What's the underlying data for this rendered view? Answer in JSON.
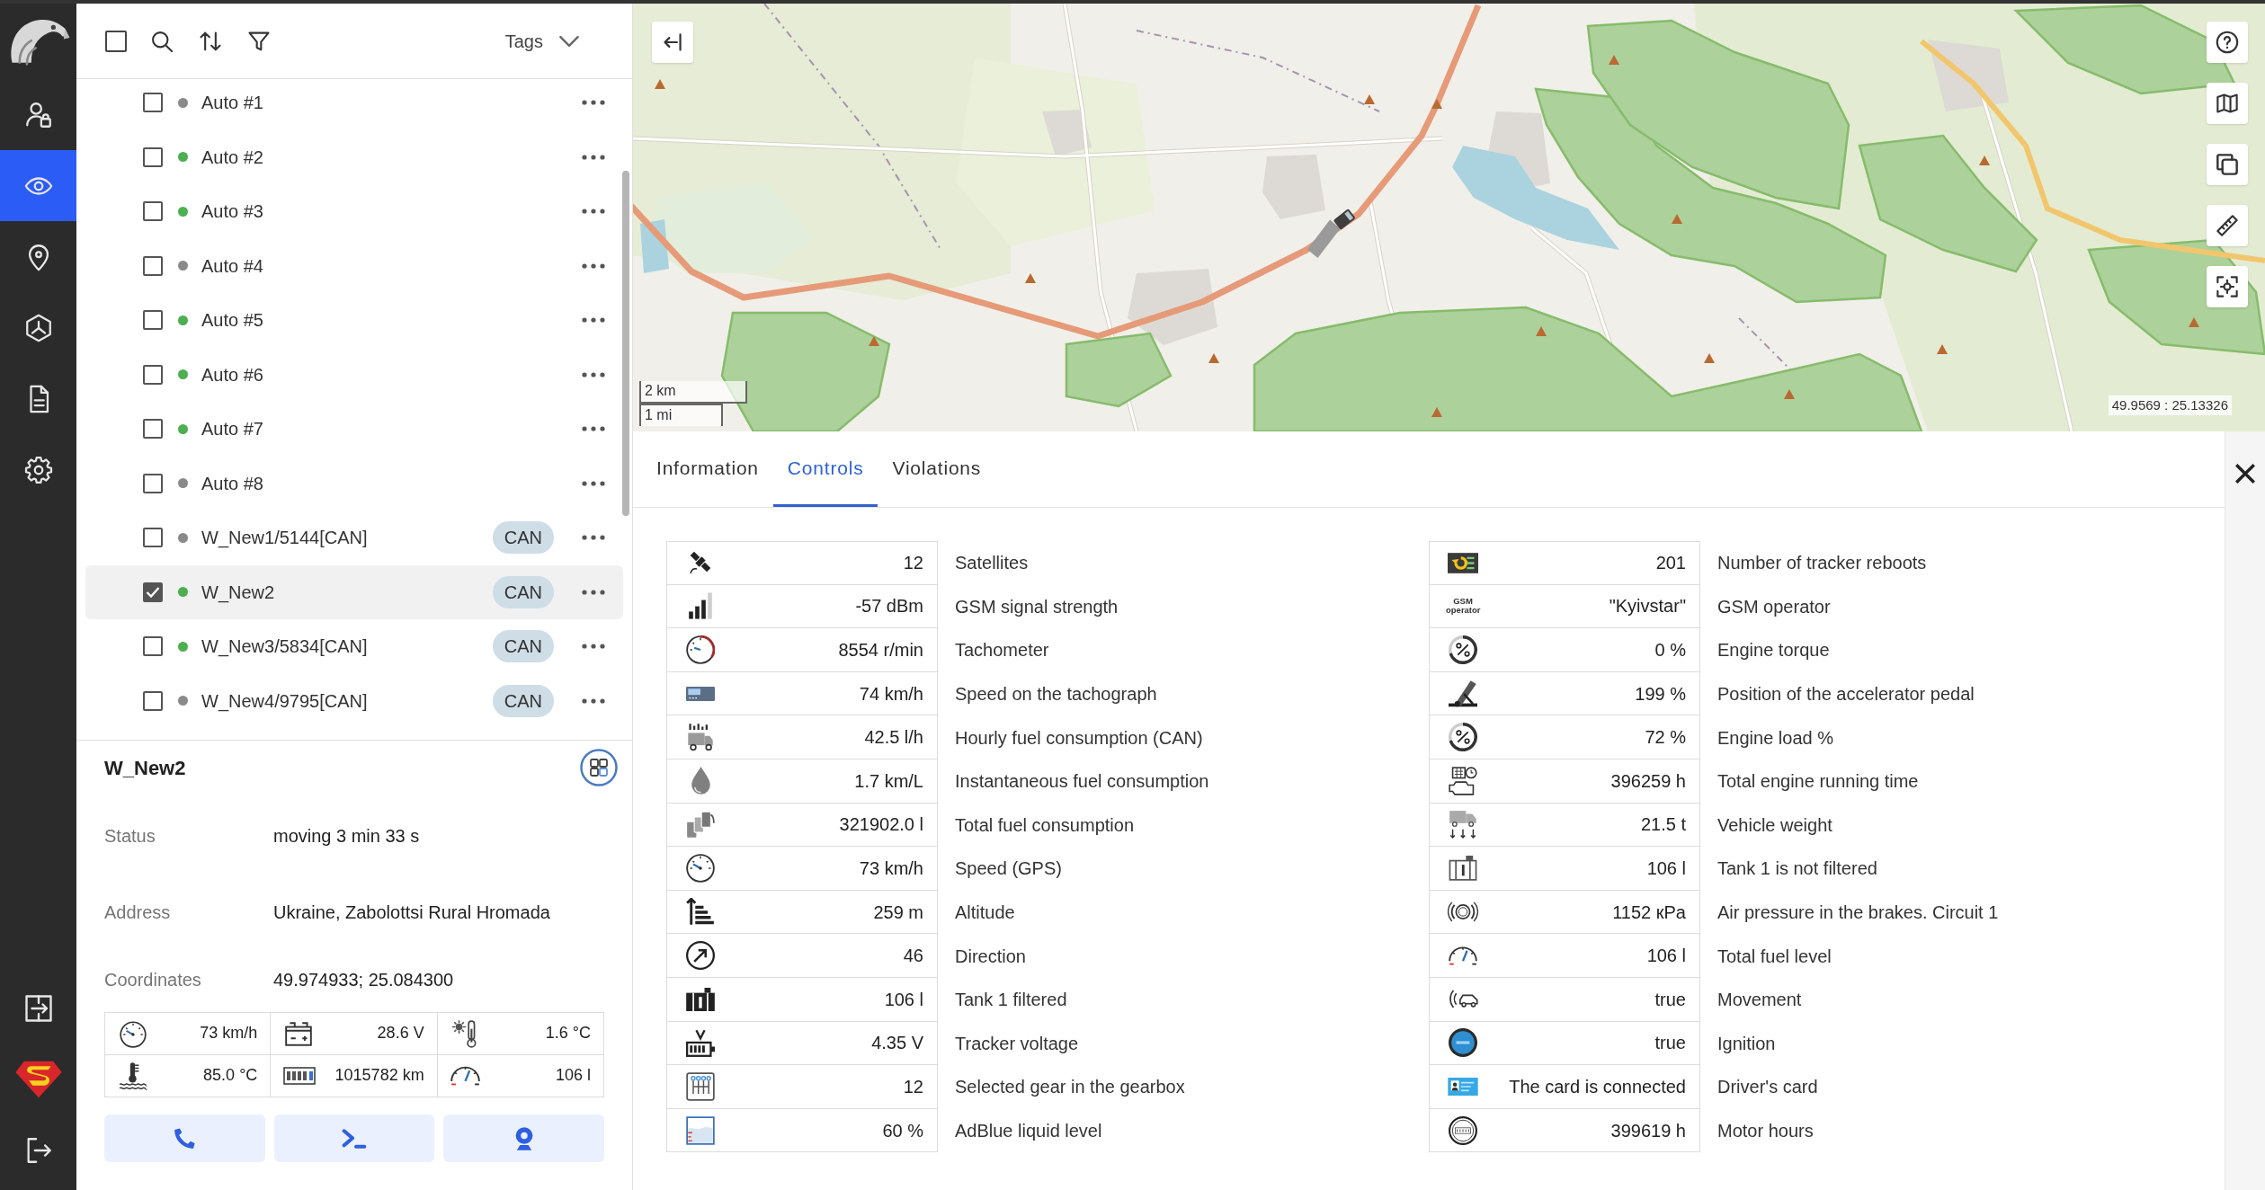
{
  "nav": {
    "items": [
      {
        "selected": false
      },
      {
        "selected": true
      },
      {
        "selected": false
      },
      {
        "selected": false
      },
      {
        "selected": false
      },
      {
        "selected": false
      }
    ]
  },
  "list_toolbar": {
    "select_all": {
      "checked": false
    },
    "tags_label": "Tags"
  },
  "vehicles": [
    {
      "name": "Auto #1",
      "color": "#8a8a8a",
      "checked": false,
      "selected": false
    },
    {
      "name": "Auto #2",
      "color": "#4caf50",
      "checked": false,
      "selected": false
    },
    {
      "name": "Auto #3",
      "color": "#4caf50",
      "checked": false,
      "selected": false
    },
    {
      "name": "Auto #4",
      "color": "#8a8a8a",
      "checked": false,
      "selected": false
    },
    {
      "name": "Auto #5",
      "color": "#4caf50",
      "checked": false,
      "selected": false
    },
    {
      "name": "Auto #6",
      "color": "#4caf50",
      "checked": false,
      "selected": false
    },
    {
      "name": "Auto #7",
      "color": "#4caf50",
      "checked": false,
      "selected": false
    },
    {
      "name": "Auto #8",
      "color": "#8a8a8a",
      "checked": false,
      "selected": false
    },
    {
      "name": "W_New1/5144[CAN]",
      "color": "#8a8a8a",
      "checked": false,
      "selected": false,
      "tag": "CAN"
    },
    {
      "name": "W_New2",
      "color": "#4caf50",
      "checked": true,
      "selected": true,
      "tag": "CAN"
    },
    {
      "name": "W_New3/5834[CAN]",
      "color": "#4caf50",
      "checked": false,
      "selected": false,
      "tag": "CAN"
    },
    {
      "name": "W_New4/9795[CAN]",
      "color": "#8a8a8a",
      "checked": false,
      "selected": false,
      "tag": "CAN"
    }
  ],
  "details": {
    "title": "W_New2",
    "fields": [
      {
        "label": "Status",
        "value": "moving 3 min 33 s"
      },
      {
        "label": "Address",
        "value": "Ukraine, Zabolottsi Rural Hromada"
      },
      {
        "label": "Coordinates",
        "value": "49.974933; 25.084300"
      }
    ],
    "sensors": [
      "73 km/h",
      "28.6 V",
      "1.6 °C",
      "85.0 °C",
      "1015782 km",
      "106 l"
    ]
  },
  "map": {
    "scale": [
      "2 km",
      "1 mi"
    ],
    "coordinates": "49.9569 : 25.13326"
  },
  "tabs": [
    {
      "label": "Information",
      "selected": false
    },
    {
      "label": "Controls",
      "selected": true
    },
    {
      "label": "Violations",
      "selected": false
    }
  ],
  "controls": {
    "left": [
      {
        "value": "12",
        "label": "Satellites"
      },
      {
        "value": "-57 dBm",
        "label": "GSM signal strength"
      },
      {
        "value": "8554 r/min",
        "label": "Tachometer"
      },
      {
        "value": "74 km/h",
        "label": "Speed on the tachograph"
      },
      {
        "value": "42.5 l/h",
        "label": "Hourly fuel consumption (CAN)"
      },
      {
        "value": "1.7 km/L",
        "label": "Instantaneous fuel consumption"
      },
      {
        "value": "321902.0 l",
        "label": "Total fuel consumption"
      },
      {
        "value": "73 km/h",
        "label": "Speed (GPS)"
      },
      {
        "value": "259 m",
        "label": "Altitude"
      },
      {
        "value": "46",
        "label": "Direction"
      },
      {
        "value": "106 l",
        "label": "Tank 1 filtered"
      },
      {
        "value": "4.35 V",
        "label": "Tracker voltage"
      },
      {
        "value": "12",
        "label": "Selected gear in the gearbox"
      },
      {
        "value": "60 %",
        "label": "AdBlue liquid level"
      }
    ],
    "right": [
      {
        "value": "201",
        "label": "Number of tracker reboots"
      },
      {
        "value": "\"Kyivstar\"",
        "label": "GSM operator",
        "icon_caption": "GSM operator"
      },
      {
        "value": "0 %",
        "label": "Engine torque"
      },
      {
        "value": "199 %",
        "label": "Position of the accelerator pedal"
      },
      {
        "value": "72 %",
        "label": "Engine load %"
      },
      {
        "value": "396259 h",
        "label": "Total engine running time"
      },
      {
        "value": "21.5 t",
        "label": "Vehicle weight"
      },
      {
        "value": "106 l",
        "label": "Tank 1 is not filtered"
      },
      {
        "value": "1152 кPa",
        "label": "Air pressure in the brakes. Circuit 1"
      },
      {
        "value": "106 l",
        "label": "Total fuel level"
      },
      {
        "value": "true",
        "label": "Movement"
      },
      {
        "value": "true",
        "label": "Ignition"
      },
      {
        "value": "The card is connected",
        "label": "Driver's card"
      },
      {
        "value": "399619 h",
        "label": "Motor hours"
      }
    ]
  }
}
